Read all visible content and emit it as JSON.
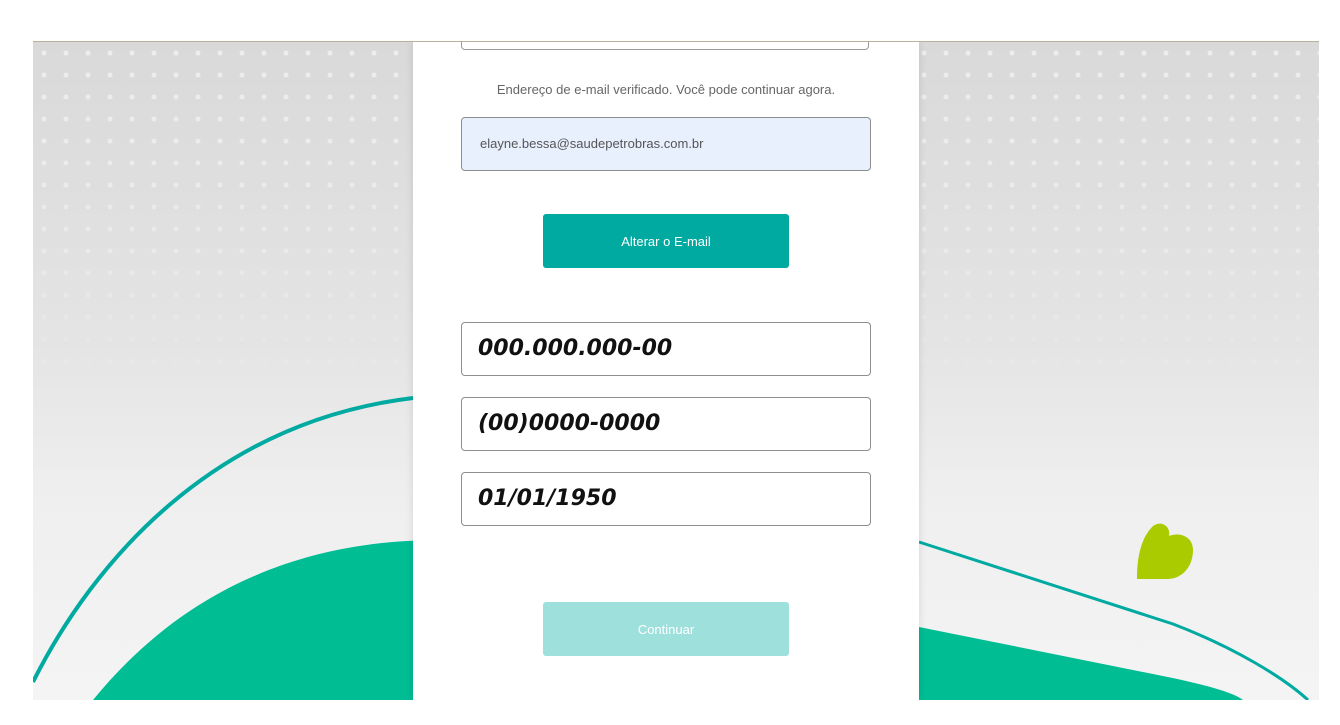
{
  "form": {
    "verified_message": "Endereço de e-mail verificado. Você pode continuar agora.",
    "email_value": "elayne.bessa@saudepetrobras.com.br",
    "change_email_label": "Alterar o E-mail",
    "cpf_value": "000.000.000-00",
    "phone_value": "(00)0000-0000",
    "birthdate_value": "01/01/1950",
    "continue_label": "Continuar"
  },
  "colors": {
    "primary_teal": "#00aaa1",
    "disabled_teal": "#9ee0dc",
    "deco_green": "#00bd94",
    "accent_lime": "#a9cb00",
    "autofill_bg": "#e8f0fe"
  },
  "icons": {
    "brand_shape": "heart-leaf-icon"
  }
}
